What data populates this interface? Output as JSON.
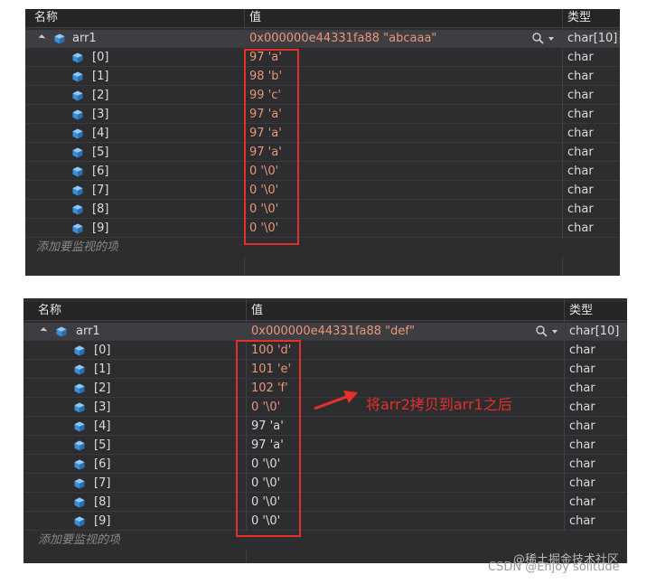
{
  "columns": {
    "name": "名称",
    "value": "值",
    "type": "类型"
  },
  "add_watch": "添加要监视的项",
  "top": {
    "parent": {
      "name": "arr1",
      "value": "0x000000e44331fa88 \"abcaaa\"",
      "type": "char[10]"
    },
    "items": [
      {
        "name": "[0]",
        "value": "97 'a'",
        "type": "char"
      },
      {
        "name": "[1]",
        "value": "98 'b'",
        "type": "char"
      },
      {
        "name": "[2]",
        "value": "99 'c'",
        "type": "char"
      },
      {
        "name": "[3]",
        "value": "97 'a'",
        "type": "char"
      },
      {
        "name": "[4]",
        "value": "97 'a'",
        "type": "char"
      },
      {
        "name": "[5]",
        "value": "97 'a'",
        "type": "char"
      },
      {
        "name": "[6]",
        "value": "0 '\\0'",
        "type": "char"
      },
      {
        "name": "[7]",
        "value": "0 '\\0'",
        "type": "char"
      },
      {
        "name": "[8]",
        "value": "0 '\\0'",
        "type": "char"
      },
      {
        "name": "[9]",
        "value": "0 '\\0'",
        "type": "char"
      }
    ]
  },
  "bottom": {
    "parent": {
      "name": "arr1",
      "value": "0x000000e44331fa88 \"def\"",
      "type": "char[10]"
    },
    "items": [
      {
        "name": "[0]",
        "value": "100 'd'",
        "type": "char"
      },
      {
        "name": "[1]",
        "value": "101 'e'",
        "type": "char"
      },
      {
        "name": "[2]",
        "value": "102 'f'",
        "type": "char"
      },
      {
        "name": "[3]",
        "value": "0 '\\0'",
        "type": "char"
      },
      {
        "name": "[4]",
        "value": "97 'a'",
        "type": "char"
      },
      {
        "name": "[5]",
        "value": "97 'a'",
        "type": "char"
      },
      {
        "name": "[6]",
        "value": "0 '\\0'",
        "type": "char"
      },
      {
        "name": "[7]",
        "value": "0 '\\0'",
        "type": "char"
      },
      {
        "name": "[8]",
        "value": "0 '\\0'",
        "type": "char"
      },
      {
        "name": "[9]",
        "value": "0 '\\0'",
        "type": "char"
      }
    ]
  },
  "annotation": "将arr2拷贝到arr1之后",
  "watermark": "CSDN @Enjoy solitude",
  "watermark_top": "@稀土掘金技术社区",
  "colors": {
    "panel_bg": "#2d2d30",
    "value_text": "#e9967a",
    "annotation_red": "#e5302a"
  },
  "icons": {
    "member": "cube-icon",
    "search": "magnifier-icon",
    "expand": "expand-triangle-icon"
  }
}
